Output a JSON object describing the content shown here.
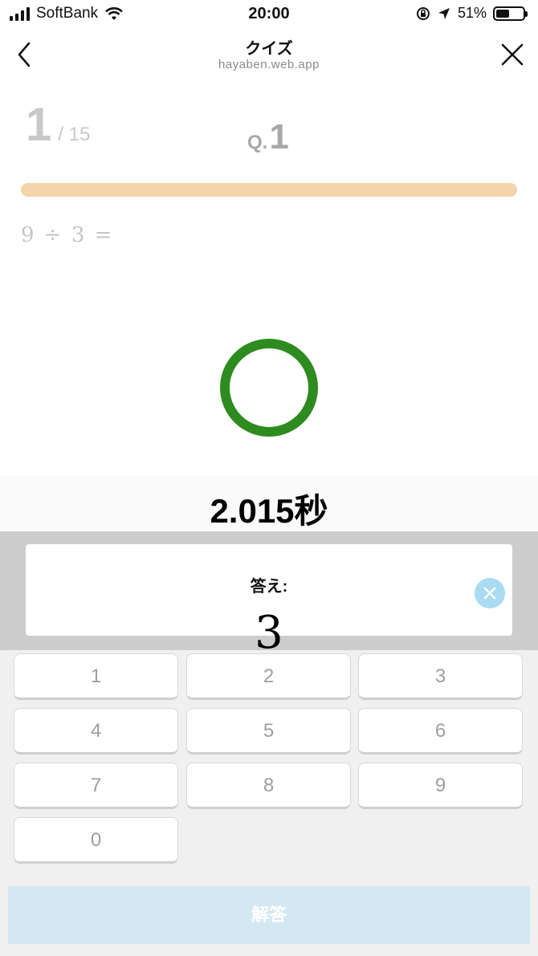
{
  "status_bar": {
    "carrier": "SoftBank",
    "time": "20:00",
    "battery": "51%",
    "battery_level": 0.51,
    "icons": [
      "signal-icon",
      "wifi-icon",
      "orientation-lock-icon",
      "location-icon",
      "battery-icon"
    ]
  },
  "header": {
    "title": "クイズ",
    "subtitle": "hayaben.web.app",
    "icons": {
      "back": "chevron-left-icon",
      "close": "close-icon"
    }
  },
  "quiz": {
    "current": "1",
    "total": "/ 15",
    "q_prefix": "Q.",
    "q_number": "1",
    "progress_fraction": 0.0,
    "question": "9 ÷ 3 =",
    "result_icon": "correct-circle-icon",
    "colors": {
      "progress": "#f4d4a8",
      "result": "#2e8b1f"
    }
  },
  "timer": {
    "text": "2.015秒"
  },
  "answer": {
    "label": "答え:",
    "value": "3",
    "clear_icon": "clear-icon"
  },
  "keypad": {
    "keys": [
      "1",
      "2",
      "3",
      "4",
      "5",
      "6",
      "7",
      "8",
      "9",
      "0"
    ],
    "submit_label": "解答",
    "colors": {
      "submit": "#d4e8f3"
    }
  }
}
